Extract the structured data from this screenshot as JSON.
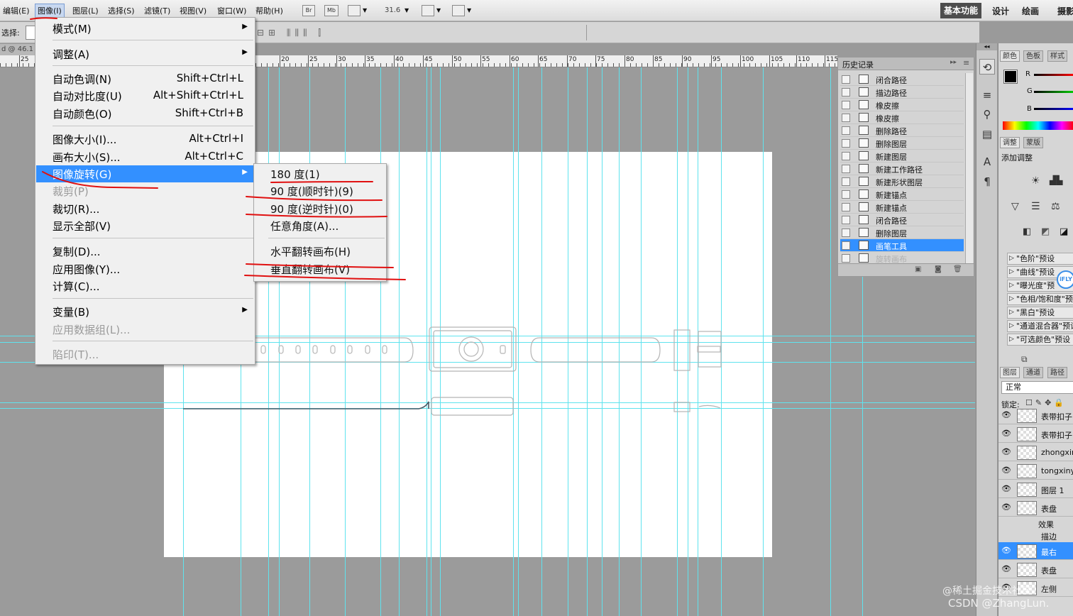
{
  "menubar": {
    "items": [
      "编辑(E)",
      "图像(I)",
      "图层(L)",
      "选择(S)",
      "滤镜(T)",
      "视图(V)",
      "窗口(W)",
      "帮助(H)"
    ],
    "br_label": "Br",
    "mb_label": "Mb",
    "zoom": "31.6",
    "workspaces": [
      "基本功能",
      "设计",
      "绘画",
      "摄影"
    ]
  },
  "optbar": {
    "select_label": "选择:"
  },
  "doc_tab": "d @ 46.1",
  "ruler": {
    "labels": [
      "25",
      "20",
      "25",
      "30",
      "35",
      "40",
      "45",
      "50",
      "55",
      "60",
      "65",
      "70",
      "75",
      "80",
      "85",
      "90",
      "95",
      "100",
      "105",
      "110",
      "115"
    ]
  },
  "menu": {
    "items": [
      {
        "label": "模式(M)",
        "shortcut": "",
        "submenu": true,
        "disabled": false
      },
      {
        "label": "调整(A)",
        "shortcut": "",
        "submenu": true,
        "disabled": false
      },
      {
        "label": "自动色调(N)",
        "shortcut": "Shift+Ctrl+L",
        "submenu": false,
        "disabled": false
      },
      {
        "label": "自动对比度(U)",
        "shortcut": "Alt+Shift+Ctrl+L",
        "submenu": false,
        "disabled": false
      },
      {
        "label": "自动颜色(O)",
        "shortcut": "Shift+Ctrl+B",
        "submenu": false,
        "disabled": false
      },
      {
        "label": "图像大小(I)...",
        "shortcut": "Alt+Ctrl+I",
        "submenu": false,
        "disabled": false
      },
      {
        "label": "画布大小(S)...",
        "shortcut": "Alt+Ctrl+C",
        "submenu": false,
        "disabled": false
      },
      {
        "label": "图像旋转(G)",
        "shortcut": "",
        "submenu": true,
        "disabled": false,
        "highlighted": true
      },
      {
        "label": "裁剪(P)",
        "shortcut": "",
        "submenu": false,
        "disabled": true
      },
      {
        "label": "裁切(R)...",
        "shortcut": "",
        "submenu": false,
        "disabled": false
      },
      {
        "label": "显示全部(V)",
        "shortcut": "",
        "submenu": false,
        "disabled": false
      },
      {
        "label": "复制(D)...",
        "shortcut": "",
        "submenu": false,
        "disabled": false
      },
      {
        "label": "应用图像(Y)...",
        "shortcut": "",
        "submenu": false,
        "disabled": false
      },
      {
        "label": "计算(C)...",
        "shortcut": "",
        "submenu": false,
        "disabled": false
      },
      {
        "label": "变量(B)",
        "shortcut": "",
        "submenu": true,
        "disabled": false
      },
      {
        "label": "应用数据组(L)...",
        "shortcut": "",
        "submenu": false,
        "disabled": true
      },
      {
        "label": "陷印(T)...",
        "shortcut": "",
        "submenu": false,
        "disabled": true
      }
    ]
  },
  "submenu": {
    "items": [
      "180 度(1)",
      "90 度(顺时针)(9)",
      "90 度(逆时针)(0)",
      "任意角度(A)...",
      "水平翻转画布(H)",
      "垂直翻转画布(V)"
    ]
  },
  "history": {
    "title": "历史记录",
    "items": [
      "闭合路径",
      "描边路径",
      "橡皮擦",
      "橡皮擦",
      "删除路径",
      "删除图层",
      "新建图层",
      "新建工作路径",
      "新建形状图层",
      "新建锚点",
      "新建锚点",
      "闭合路径",
      "删除图层",
      "画笔工具",
      "旋转画布"
    ],
    "selected_index": 13
  },
  "color_panel": {
    "tabs": [
      "颜色",
      "色板",
      "样式"
    ],
    "channels": [
      "R",
      "G",
      "B"
    ],
    "fg_color": "#000000"
  },
  "adjust_panel": {
    "tabs": [
      "调整",
      "蒙版"
    ],
    "title": "添加调整",
    "presets": [
      "\"色阶\"预设",
      "\"曲线\"预设",
      "\"曝光度\"预",
      "\"色相/饱和度\"预",
      "\"黑白\"预设",
      "\"通道混合器\"预设",
      "\"可选颜色\"预设"
    ],
    "badge": "iFLY"
  },
  "layers_panel": {
    "tabs": [
      "图层",
      "通道",
      "路径"
    ],
    "blend_mode": "正常",
    "lock_label": "锁定:",
    "layers": [
      "表带扣子",
      "表带扣子",
      "zhongxin",
      "tongxinyua",
      "图层 1",
      "表盘",
      "最右",
      "表盘",
      "左侧"
    ],
    "effects_label": "效果",
    "stroke_label": "描边",
    "selected_index": 6
  },
  "watermark": {
    "line1": "@稀土掘金技术社区",
    "line2": "CSDN @ZhangLun."
  },
  "colors": {
    "accent": "#3390ff",
    "guide": "#5fe3ee",
    "annotation": "#e01010"
  }
}
